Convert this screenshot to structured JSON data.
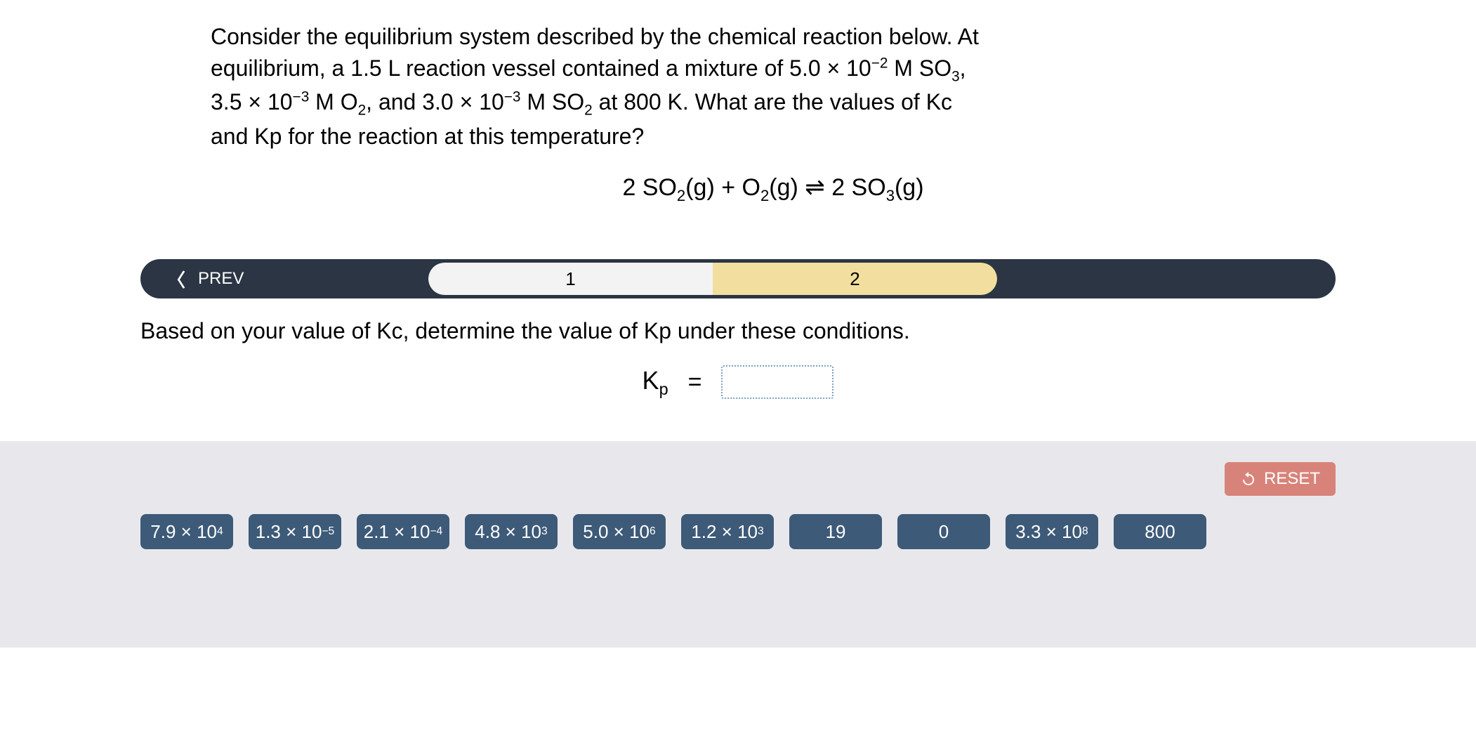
{
  "question": {
    "line1": "Consider the equilibrium system described by the chemical reaction below. At",
    "line2_pre": "equilibrium, a 1.5 L reaction vessel contained a mixture of 5.0 × 10",
    "line2_exp1": "−2",
    "line2_mid": " M SO",
    "line2_sub1": "3",
    "line2_end": ",",
    "line3_a": "3.5 × 10",
    "line3_exp1": "−3",
    "line3_b": " M O",
    "line3_sub1": "2",
    "line3_c": ", and 3.0 × 10",
    "line3_exp2": "−3",
    "line3_d": " M SO",
    "line3_sub2": "2",
    "line3_e": " at 800 K. What are the values of Kc",
    "line4": "and Kp for the reaction at this temperature?"
  },
  "equation": {
    "p1": "2 SO",
    "s1": "2",
    "p2": "(g) + O",
    "s2": "2",
    "p3": "(g) ⇌ 2 SO",
    "s3": "3",
    "p4": "(g)"
  },
  "nav": {
    "prev": "PREV",
    "step1": "1",
    "step2": "2"
  },
  "sub_question": "Based on your value of Kc, determine the value of Kp under these conditions.",
  "kp": {
    "label_k": "K",
    "label_sub": "p",
    "equals": "="
  },
  "reset": "RESET",
  "tiles": [
    {
      "base": "7.9 × 10",
      "exp": "4"
    },
    {
      "base": "1.3 × 10",
      "exp": "−5"
    },
    {
      "base": "2.1 × 10",
      "exp": "−4"
    },
    {
      "base": "4.8 × 10",
      "exp": "3"
    },
    {
      "base": "5.0 × 10",
      "exp": "6"
    },
    {
      "base": "1.2 × 10",
      "exp": "3"
    },
    {
      "base": "19",
      "exp": ""
    },
    {
      "base": "0",
      "exp": ""
    },
    {
      "base": "3.3 × 10",
      "exp": "8"
    },
    {
      "base": "800",
      "exp": ""
    }
  ]
}
